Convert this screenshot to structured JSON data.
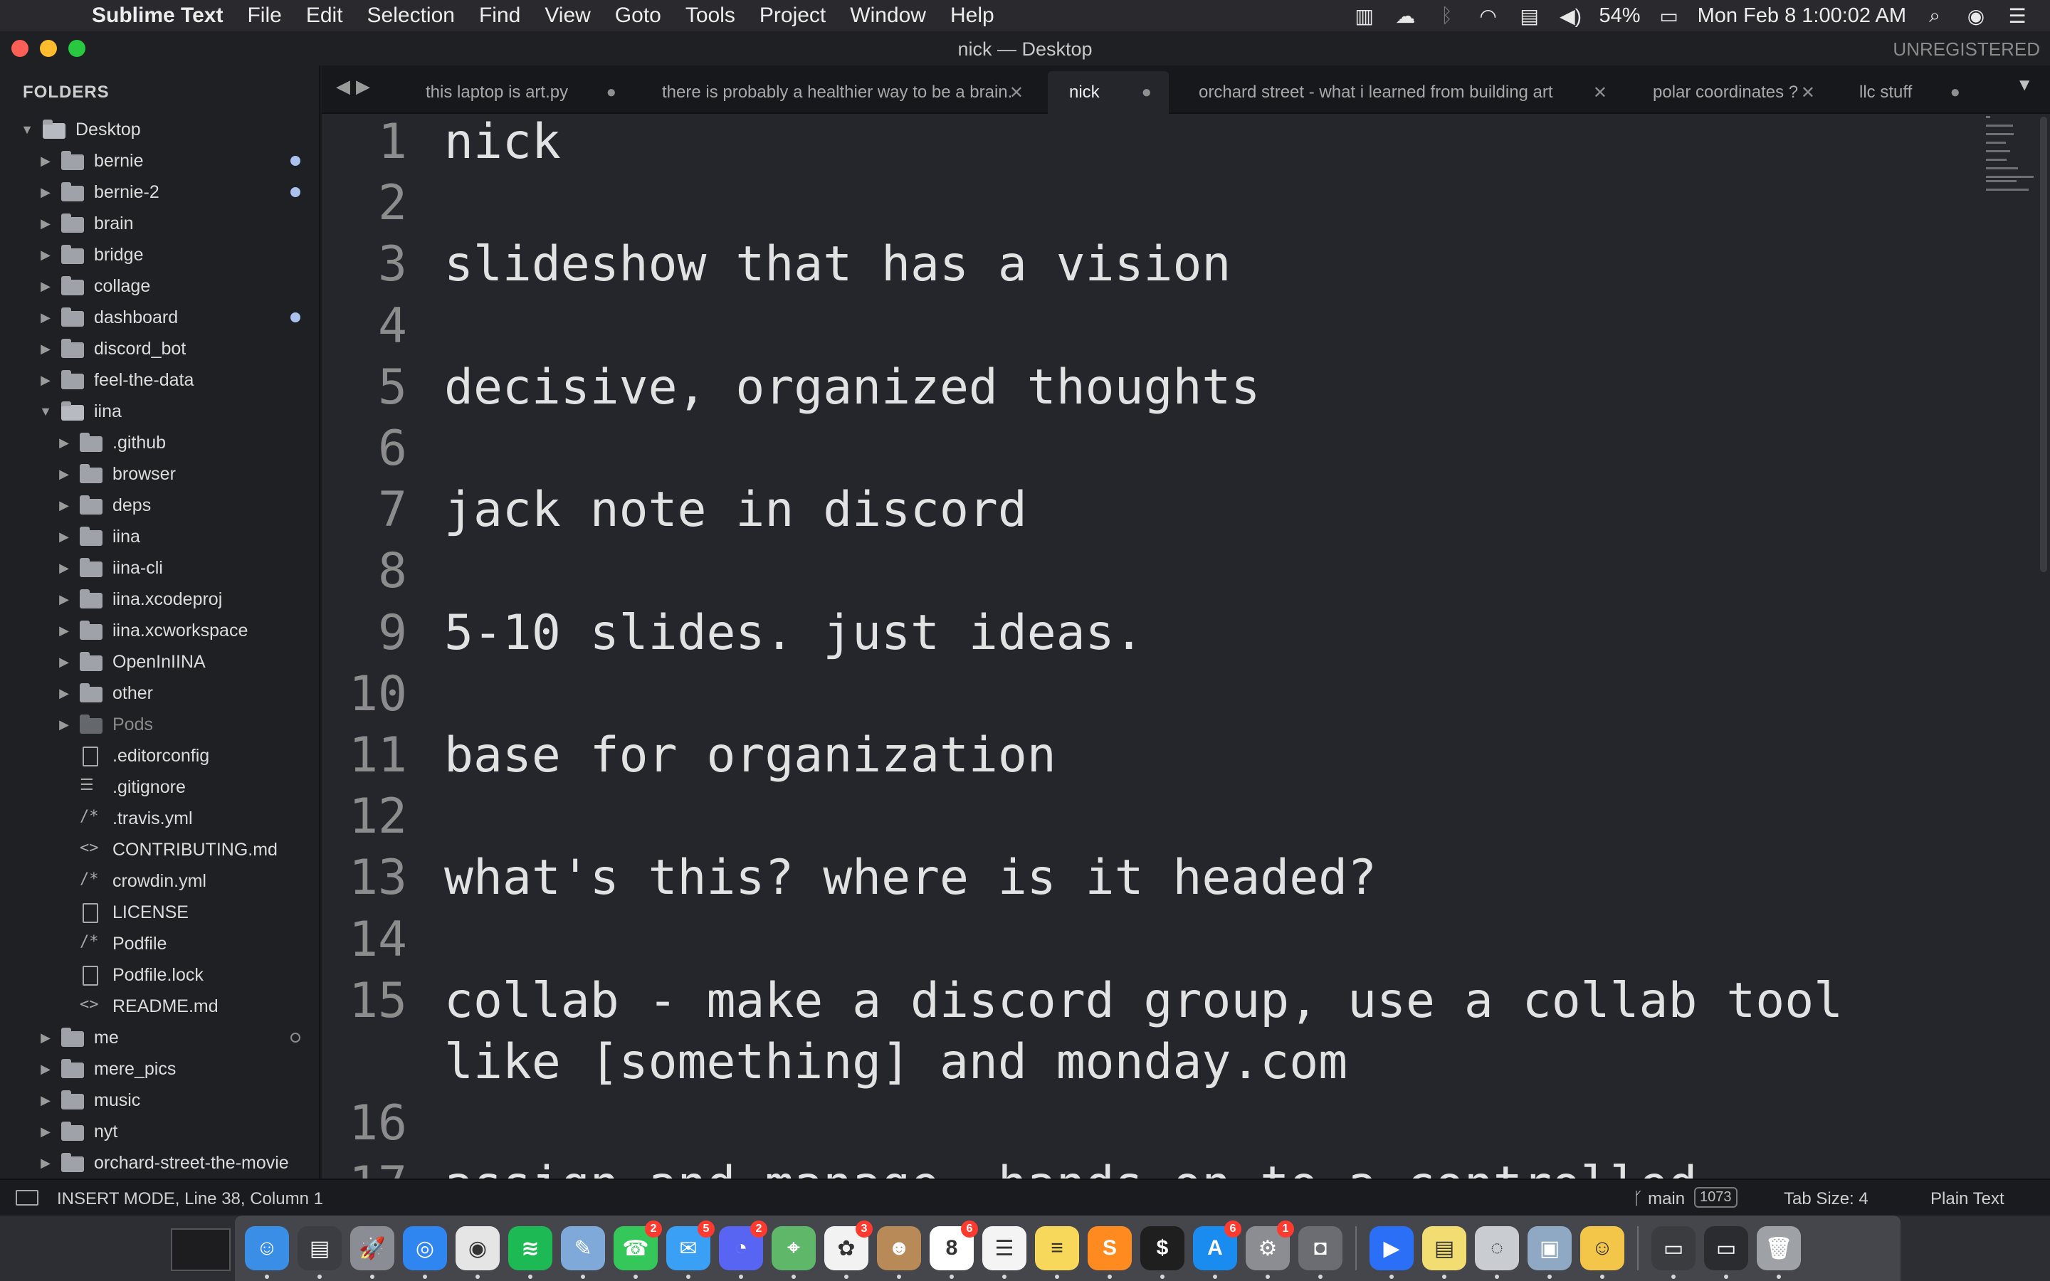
{
  "menubar": {
    "app_name": "Sublime Text",
    "menus": [
      "File",
      "Edit",
      "Selection",
      "Find",
      "View",
      "Goto",
      "Tools",
      "Project",
      "Window",
      "Help"
    ],
    "battery": "54%",
    "datetime": "Mon Feb 8  1:00:02 AM"
  },
  "window": {
    "title": "nick — Desktop",
    "registration": "UNREGISTERED"
  },
  "sidebar": {
    "header": "FOLDERS",
    "items": [
      {
        "label": "Desktop",
        "type": "folder-open",
        "depth": 0,
        "dot": ""
      },
      {
        "label": "bernie",
        "type": "folder",
        "depth": 1,
        "dot": "filled"
      },
      {
        "label": "bernie-2",
        "type": "folder",
        "depth": 1,
        "dot": "filled"
      },
      {
        "label": "brain",
        "type": "folder",
        "depth": 1,
        "dot": ""
      },
      {
        "label": "bridge",
        "type": "folder",
        "depth": 1,
        "dot": ""
      },
      {
        "label": "collage",
        "type": "folder",
        "depth": 1,
        "dot": ""
      },
      {
        "label": "dashboard",
        "type": "folder",
        "depth": 1,
        "dot": "filled"
      },
      {
        "label": "discord_bot",
        "type": "folder",
        "depth": 1,
        "dot": ""
      },
      {
        "label": "feel-the-data",
        "type": "folder",
        "depth": 1,
        "dot": ""
      },
      {
        "label": "iina",
        "type": "folder-open",
        "depth": 1,
        "dot": ""
      },
      {
        "label": ".github",
        "type": "folder",
        "depth": 2,
        "dot": ""
      },
      {
        "label": "browser",
        "type": "folder",
        "depth": 2,
        "dot": ""
      },
      {
        "label": "deps",
        "type": "folder",
        "depth": 2,
        "dot": ""
      },
      {
        "label": "iina",
        "type": "folder",
        "depth": 2,
        "dot": ""
      },
      {
        "label": "iina-cli",
        "type": "folder",
        "depth": 2,
        "dot": ""
      },
      {
        "label": "iina.xcodeproj",
        "type": "folder",
        "depth": 2,
        "dot": ""
      },
      {
        "label": "iina.xcworkspace",
        "type": "folder",
        "depth": 2,
        "dot": ""
      },
      {
        "label": "OpenInIINA",
        "type": "folder",
        "depth": 2,
        "dot": ""
      },
      {
        "label": "other",
        "type": "folder",
        "depth": 2,
        "dot": ""
      },
      {
        "label": "Pods",
        "type": "folder",
        "depth": 2,
        "dot": "",
        "dim": true
      },
      {
        "label": ".editorconfig",
        "type": "file",
        "depth": 2,
        "dot": ""
      },
      {
        "label": ".gitignore",
        "type": "file-lines",
        "depth": 2,
        "dot": ""
      },
      {
        "label": ".travis.yml",
        "type": "file-comment",
        "depth": 2,
        "dot": ""
      },
      {
        "label": "CONTRIBUTING.md",
        "type": "file-code",
        "depth": 2,
        "dot": ""
      },
      {
        "label": "crowdin.yml",
        "type": "file-comment",
        "depth": 2,
        "dot": ""
      },
      {
        "label": "LICENSE",
        "type": "file",
        "depth": 2,
        "dot": ""
      },
      {
        "label": "Podfile",
        "type": "file-comment",
        "depth": 2,
        "dot": ""
      },
      {
        "label": "Podfile.lock",
        "type": "file",
        "depth": 2,
        "dot": ""
      },
      {
        "label": "README.md",
        "type": "file-code",
        "depth": 2,
        "dot": ""
      },
      {
        "label": "me",
        "type": "folder",
        "depth": 1,
        "dot": "hollow"
      },
      {
        "label": "mere_pics",
        "type": "folder",
        "depth": 1,
        "dot": ""
      },
      {
        "label": "music",
        "type": "folder",
        "depth": 1,
        "dot": ""
      },
      {
        "label": "nyt",
        "type": "folder",
        "depth": 1,
        "dot": ""
      },
      {
        "label": "orchard-street-the-movie",
        "type": "folder",
        "depth": 1,
        "dot": ""
      }
    ]
  },
  "tabs": [
    {
      "label": "this laptop is art.py",
      "control": "●",
      "active": false
    },
    {
      "label": "there is probably a healthier way to be a brain.",
      "control": "✕",
      "active": false
    },
    {
      "label": "nick",
      "control": "●",
      "active": true
    },
    {
      "label": "orchard street - what i learned from building art",
      "control": "✕",
      "active": false
    },
    {
      "label": "polar coordinates ?",
      "control": "✕",
      "active": false
    },
    {
      "label": "llc stuff",
      "control": "●",
      "active": false
    }
  ],
  "editor": {
    "lines": [
      {
        "n": "1",
        "text": "nick"
      },
      {
        "n": "2",
        "text": ""
      },
      {
        "n": "3",
        "text": "slideshow that has a vision"
      },
      {
        "n": "4",
        "text": ""
      },
      {
        "n": "5",
        "text": "decisive, organized thoughts"
      },
      {
        "n": "6",
        "text": ""
      },
      {
        "n": "7",
        "text": "jack note in discord"
      },
      {
        "n": "8",
        "text": ""
      },
      {
        "n": "9",
        "text": "5-10 slides. just ideas."
      },
      {
        "n": "10",
        "text": ""
      },
      {
        "n": "11",
        "text": "base for organization"
      },
      {
        "n": "12",
        "text": ""
      },
      {
        "n": "13",
        "text": "what's this? where is it headed?"
      },
      {
        "n": "14",
        "text": ""
      },
      {
        "n": "15",
        "text": "collab - make a discord group, use a collab tool"
      },
      {
        "n": "",
        "text": "like [something] and monday.com"
      },
      {
        "n": "16",
        "text": ""
      },
      {
        "n": "17",
        "text": "assign and manage. hands on to a controlled"
      }
    ]
  },
  "statusbar": {
    "mode": "INSERT MODE, Line 38, Column 1",
    "branch": "main",
    "branch_count": "1073",
    "tab_size": "Tab Size: 4",
    "syntax": "Plain Text"
  },
  "dock": {
    "apps": [
      {
        "name": "Finder",
        "color": "#3a8ee6",
        "glyph": "☺",
        "badge": ""
      },
      {
        "name": "Activity Monitor",
        "color": "#3b3d42",
        "glyph": "▤",
        "badge": ""
      },
      {
        "name": "Launchpad",
        "color": "#8a8d93",
        "glyph": "🚀",
        "badge": ""
      },
      {
        "name": "Safari",
        "color": "#2f86f0",
        "glyph": "◎",
        "badge": ""
      },
      {
        "name": "Chrome",
        "color": "#e5e5e5",
        "glyph": "◉",
        "badge": ""
      },
      {
        "name": "Spotify",
        "color": "#1db954",
        "glyph": "≋",
        "badge": ""
      },
      {
        "name": "Preview",
        "color": "#7fa9d8",
        "glyph": "✎",
        "badge": ""
      },
      {
        "name": "FaceTime",
        "color": "#35c759",
        "glyph": "☎",
        "badge": "2"
      },
      {
        "name": "Messages",
        "color": "#3aa0f5",
        "glyph": "✉",
        "badge": "5"
      },
      {
        "name": "Discord",
        "color": "#5865f2",
        "glyph": "◔",
        "badge": "2"
      },
      {
        "name": "Maps",
        "color": "#5fb86a",
        "glyph": "⌖",
        "badge": ""
      },
      {
        "name": "Photos",
        "color": "#f2f2f2",
        "glyph": "✿",
        "badge": "3"
      },
      {
        "name": "Contacts",
        "color": "#b78a57",
        "glyph": "☻",
        "badge": ""
      },
      {
        "name": "Calendar",
        "color": "#ffffff",
        "glyph": "8",
        "badge": "6"
      },
      {
        "name": "Reminders",
        "color": "#f4f4f4",
        "glyph": "☰",
        "badge": ""
      },
      {
        "name": "Notes",
        "color": "#f7d85a",
        "glyph": "≡",
        "badge": ""
      },
      {
        "name": "Sublime Text",
        "color": "#ff8a1f",
        "glyph": "S",
        "badge": ""
      },
      {
        "name": "Terminal",
        "color": "#1f1f1f",
        "glyph": "$",
        "badge": ""
      },
      {
        "name": "App Store",
        "color": "#1a8cf0",
        "glyph": "A",
        "badge": "6"
      },
      {
        "name": "System Preferences",
        "color": "#8b8d92",
        "glyph": "⚙",
        "badge": "1"
      },
      {
        "name": "Screenshot",
        "color": "#6b6d72",
        "glyph": "◘",
        "badge": ""
      },
      {
        "name": "Zoom",
        "color": "#2b6ff7",
        "glyph": "▶",
        "badge": ""
      },
      {
        "name": "Stickies",
        "color": "#f2dd72",
        "glyph": "▤",
        "badge": ""
      },
      {
        "name": "Disk Utility",
        "color": "#c9ccd1",
        "glyph": "◌",
        "badge": ""
      },
      {
        "name": "Image Capture",
        "color": "#8fa9c4",
        "glyph": "▣",
        "badge": ""
      },
      {
        "name": "Memoji",
        "color": "#f3c64a",
        "glyph": "☺",
        "badge": ""
      },
      {
        "name": "Window 1",
        "color": "#3a3c40",
        "glyph": "▭",
        "badge": ""
      },
      {
        "name": "Window 2",
        "color": "#2a2c30",
        "glyph": "▭",
        "badge": ""
      },
      {
        "name": "Trash",
        "color": "#9ea1a6",
        "glyph": "🗑",
        "badge": ""
      }
    ]
  }
}
